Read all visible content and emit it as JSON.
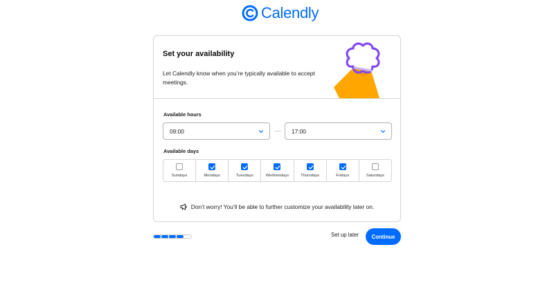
{
  "brand": {
    "name": "Calendly",
    "color": "#006bff"
  },
  "card": {
    "title": "Set your availability",
    "description": "Let Calendly know when you’re typically available to accept meetings."
  },
  "hours": {
    "label": "Available hours",
    "start": "09:00",
    "end": "17:00"
  },
  "days": {
    "label": "Available days",
    "items": [
      {
        "label": "Sundays",
        "checked": false
      },
      {
        "label": "Mondays",
        "checked": true
      },
      {
        "label": "Tuesdays",
        "checked": true
      },
      {
        "label": "Wednesdays",
        "checked": true
      },
      {
        "label": "Thursdays",
        "checked": true
      },
      {
        "label": "Fridays",
        "checked": true
      },
      {
        "label": "Saturdays",
        "checked": false
      }
    ]
  },
  "note": {
    "icon": "megaphone-icon",
    "text": "Don’t worry! You’ll be able to further customize your availability later on."
  },
  "footer": {
    "progress": {
      "completed_steps": 4,
      "total_steps": 5
    },
    "setup_later": "Set up later",
    "continue": "Continue"
  }
}
